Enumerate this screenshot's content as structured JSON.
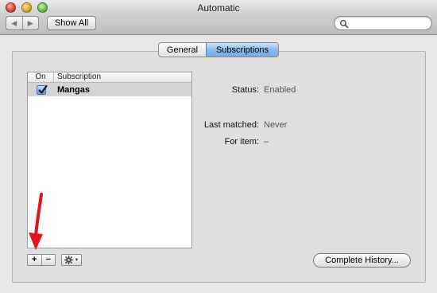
{
  "window": {
    "title": "Automatic"
  },
  "toolbar": {
    "back": "◀",
    "forward": "▶",
    "show_all_label": "Show All",
    "search_value": "",
    "search_placeholder": ""
  },
  "tabs": [
    {
      "label": "General",
      "selected": false
    },
    {
      "label": "Subscriptions",
      "selected": true
    }
  ],
  "list": {
    "columns": {
      "on": "On",
      "subscription": "Subscription"
    },
    "rows": [
      {
        "on": true,
        "name": "Mangas",
        "selected": true
      }
    ],
    "add_label": "+",
    "remove_label": "−"
  },
  "details": {
    "status_label": "Status:",
    "status_value": "Enabled",
    "last_matched_label": "Last matched:",
    "last_matched_value": "Never",
    "for_item_label": "For item:",
    "for_item_value": "–"
  },
  "history_button": "Complete History...",
  "icons": {
    "search": "search-icon",
    "gear": "gear-icon",
    "arrow": "red-arrow-annotation"
  },
  "colors": {
    "selection": "#d4d4d4",
    "tab_active": "#8fb8ec",
    "annotation": "#e0141a"
  }
}
